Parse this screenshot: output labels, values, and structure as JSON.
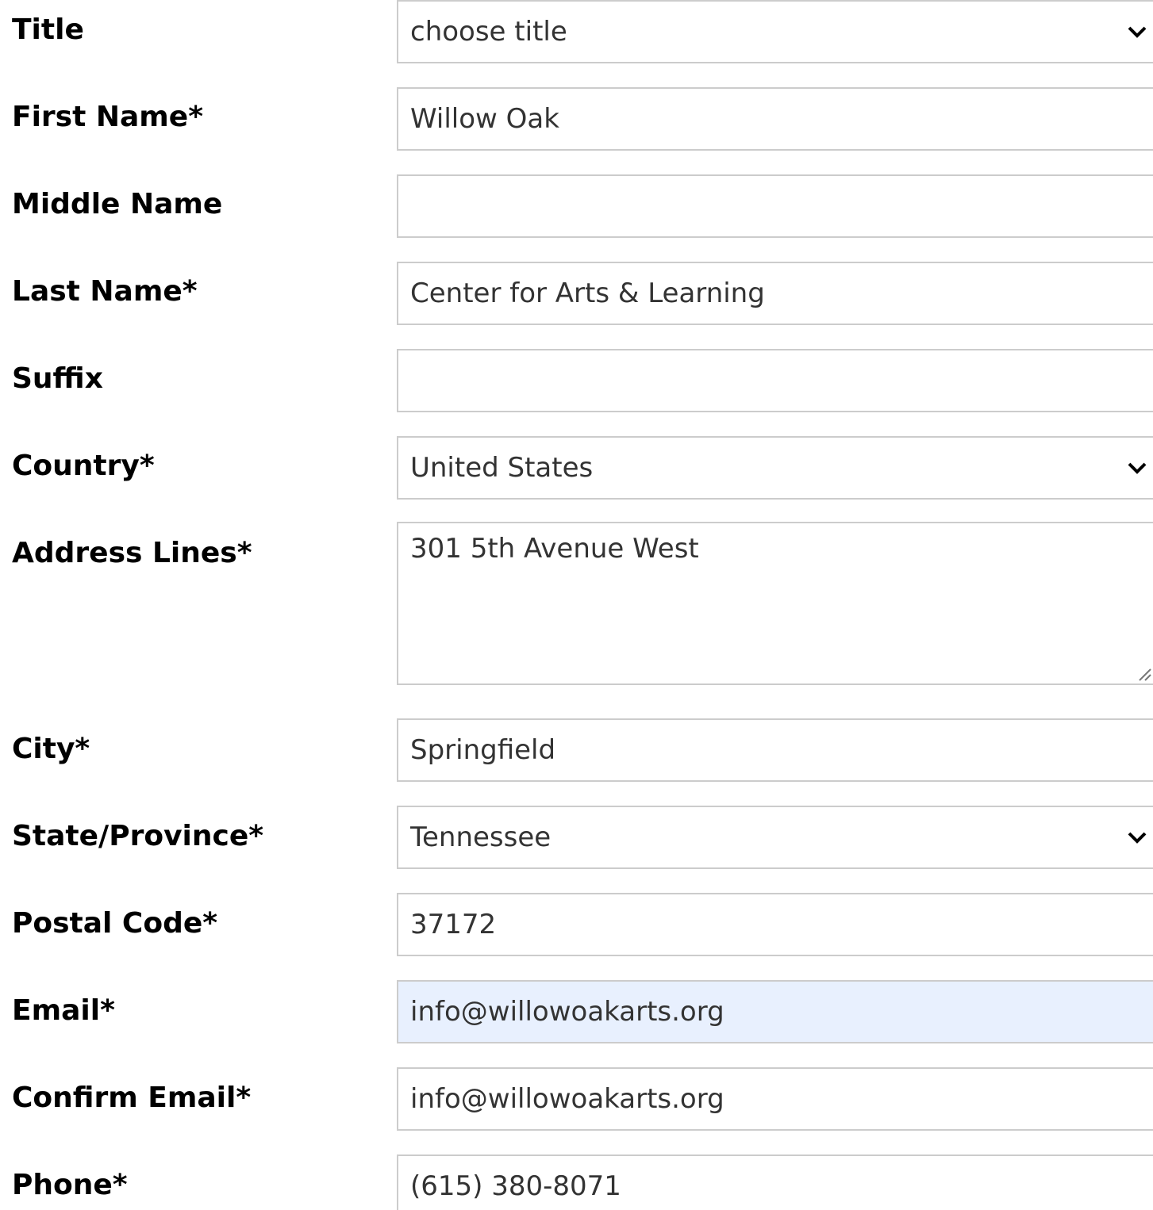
{
  "form": {
    "fields": {
      "title": {
        "label": "Title",
        "value": "choose title"
      },
      "first_name": {
        "label": "First Name*",
        "value": "Willow Oak"
      },
      "middle_name": {
        "label": "Middle Name",
        "value": ""
      },
      "last_name": {
        "label": "Last Name*",
        "value": "Center for Arts & Learning"
      },
      "suffix": {
        "label": "Suffix",
        "value": ""
      },
      "country": {
        "label": "Country*",
        "value": "United States"
      },
      "address_lines": {
        "label": "Address Lines*",
        "value": "301 5th Avenue West"
      },
      "city": {
        "label": "City*",
        "value": "Springfield"
      },
      "state": {
        "label": "State/Province*",
        "value": "Tennessee"
      },
      "postal_code": {
        "label": "Postal Code*",
        "value": "37172"
      },
      "email": {
        "label": "Email*",
        "value": "info@willowoakarts.org"
      },
      "confirm_email": {
        "label": "Confirm Email*",
        "value": "info@willowoakarts.org"
      },
      "phone": {
        "label": "Phone*",
        "value": "(615) 380-8071"
      }
    },
    "icons": {
      "dropdown": "chevron-down-icon",
      "resize": "resize-grip-icon"
    },
    "colors": {
      "border": "#cccccc",
      "autofill_background": "#e8f0fe",
      "label_text": "#000000",
      "field_text": "#333333"
    }
  }
}
